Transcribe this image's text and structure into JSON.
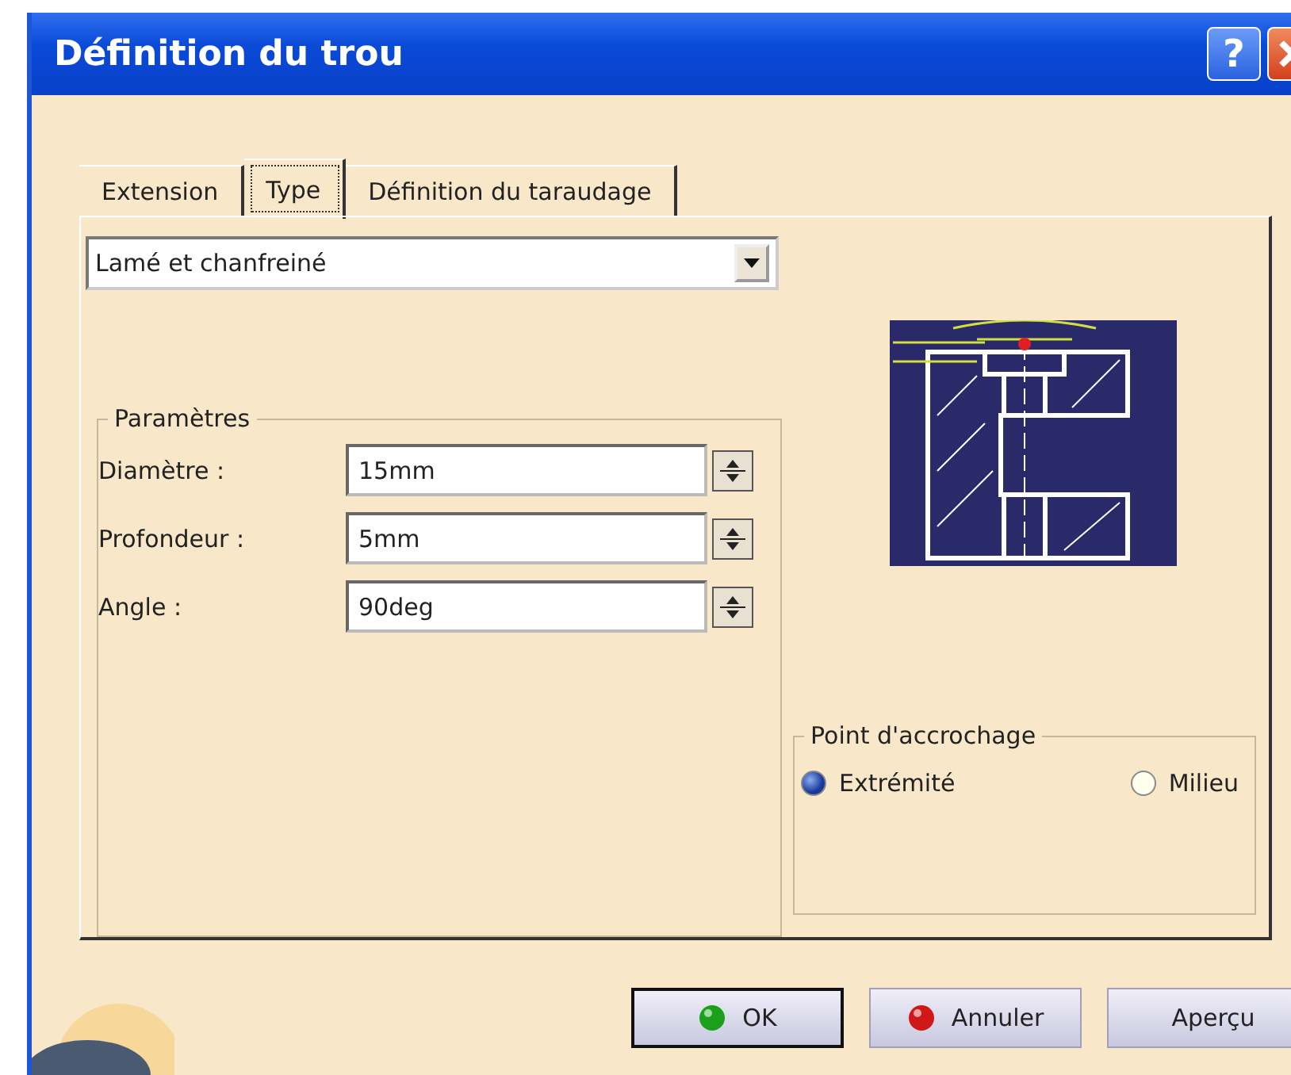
{
  "window": {
    "title": "Définition du trou",
    "help_label": "?"
  },
  "tabs": [
    {
      "label": "Extension",
      "selected": false
    },
    {
      "label": "Type",
      "selected": true
    },
    {
      "label": "Définition du taraudage",
      "selected": false
    }
  ],
  "hole_type": {
    "value": "Lamé et chanfreiné"
  },
  "parameters": {
    "title": "Paramètres",
    "fields": [
      {
        "label": "Diamètre :",
        "value": "15mm"
      },
      {
        "label": "Profondeur :",
        "value": "5mm"
      },
      {
        "label": "Angle :",
        "value": "90deg"
      }
    ]
  },
  "anchor_point": {
    "title": "Point d'accrochage",
    "options": [
      {
        "label": "Extrémité",
        "selected": true
      },
      {
        "label": "Milieu",
        "selected": false
      }
    ]
  },
  "buttons": [
    {
      "label": "OK",
      "kind": "ok"
    },
    {
      "label": "Annuler",
      "kind": "cancel"
    },
    {
      "label": "Aperçu",
      "kind": "preview"
    }
  ]
}
